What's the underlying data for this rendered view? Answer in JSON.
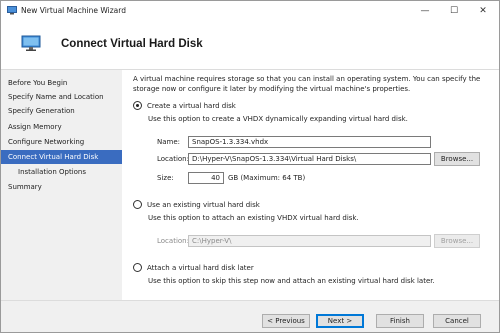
{
  "window": {
    "title": "New Virtual Machine Wizard",
    "minimize_glyph": "—",
    "maximize_glyph": "☐",
    "close_glyph": "✕"
  },
  "header": {
    "title": "Connect Virtual Hard Disk",
    "icon": "monitor-icon"
  },
  "nav": {
    "items": [
      {
        "label": "Before You Begin",
        "active": false
      },
      {
        "label": "Specify Name and Location",
        "active": false
      },
      {
        "label": "Specify Generation",
        "active": false
      },
      {
        "label": "Assign Memory",
        "active": false
      },
      {
        "label": "Configure Networking",
        "active": false
      },
      {
        "label": "Connect Virtual Hard Disk",
        "active": true
      },
      {
        "label": "Installation Options",
        "active": false
      },
      {
        "label": "Summary",
        "active": false
      }
    ]
  },
  "content": {
    "intro": "A virtual machine requires storage so that you can install an operating system. You can specify the storage now or configure it later by modifying the virtual machine's properties.",
    "create": {
      "label": "Create a virtual hard disk",
      "selected": true,
      "desc": "Use this option to create a VHDX dynamically expanding virtual hard disk.",
      "name_label": "Name:",
      "name_value": "SnapOS-1.3.334.vhdx",
      "location_label": "Location:",
      "location_value": "D:\\Hyper-V\\SnapOS-1.3.334\\Virtual Hard Disks\\",
      "browse_label": "Browse...",
      "size_label": "Size:",
      "size_value": "40",
      "size_suffix": "GB (Maximum: 64 TB)"
    },
    "existing": {
      "label": "Use an existing virtual hard disk",
      "selected": false,
      "desc": "Use this option to attach an existing VHDX virtual hard disk.",
      "location_label": "Location:",
      "location_value": "C:\\Hyper-V\\",
      "browse_label": "Browse..."
    },
    "later": {
      "label": "Attach a virtual hard disk later",
      "selected": false,
      "desc": "Use this option to skip this step now and attach an existing virtual hard disk later."
    }
  },
  "footer": {
    "previous_label": "< Previous",
    "next_label": "Next >",
    "finish_label": "Finish",
    "cancel_label": "Cancel"
  },
  "colors": {
    "accent": "#3a6cc0",
    "primary_border": "#0078d7"
  }
}
